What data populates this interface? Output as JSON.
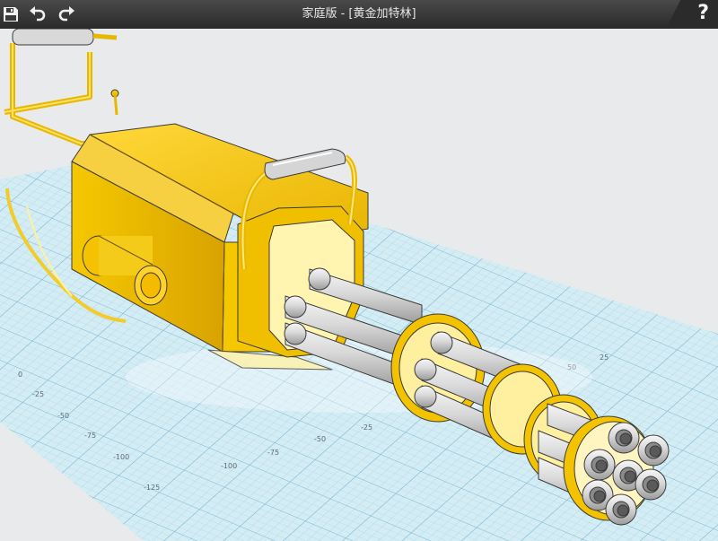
{
  "titlebar": {
    "title": "家庭版 - [黄金加特林]",
    "help_label": "?"
  },
  "icons": {
    "save": "save-icon",
    "undo": "undo-icon",
    "redo": "redo-icon",
    "help": "help-icon"
  },
  "grid": {
    "labels_left": [
      "0",
      "-25",
      "-50",
      "-75",
      "-100",
      "-125"
    ],
    "labels_bottom": [
      "-25",
      "-50",
      "-75",
      "-100"
    ],
    "labels_right": [
      "25",
      "50"
    ]
  },
  "colors": {
    "titlebar": "#2f2f2f",
    "background": "#e9eaec",
    "grid_line": "#8cc6dc",
    "body_gold": "#f1c30a",
    "barrel": "#cfcfcf"
  }
}
